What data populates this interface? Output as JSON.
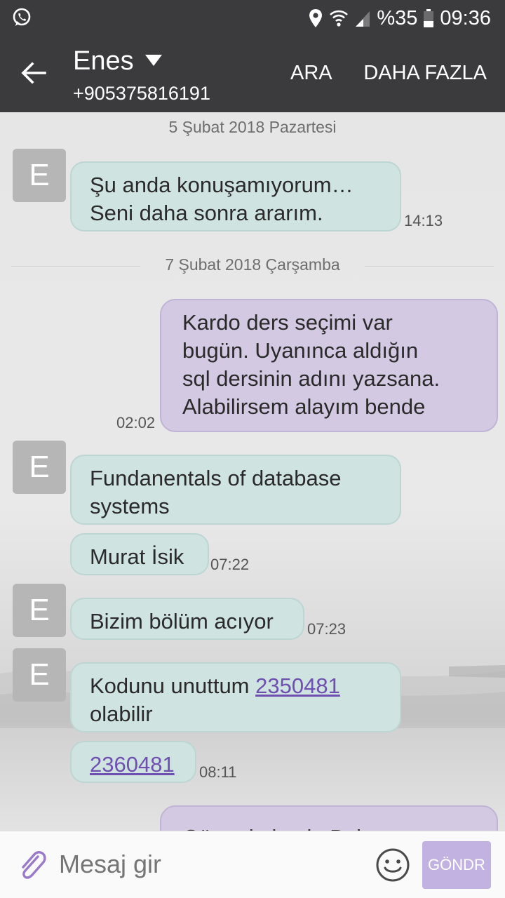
{
  "status_bar": {
    "battery": "%35",
    "time": "09:36"
  },
  "header": {
    "contact_name": "Enes",
    "phone": "+905375816191",
    "call_label": "ARA",
    "more_label": "DAHA FAZLA"
  },
  "chat": {
    "dates": [
      "5 Şubat 2018 Pazartesi",
      "7 Şubat 2018 Çarşamba"
    ],
    "avatar_letter": "E",
    "messages": [
      {
        "direction": "in",
        "lines": [
          "Şu anda konuşamıyorum…",
          "Seni daha sonra ararım."
        ],
        "time": "14:13"
      },
      {
        "direction": "out",
        "lines": [
          "Kardo ders seçimi var",
          "bugün. Uyanınca aldığın",
          "sql dersinin adını yazsana.",
          "Alabilirsem alayım bende"
        ],
        "time": "02:02"
      },
      {
        "direction": "in",
        "lines": [
          "Fundanentals of database",
          "systems"
        ]
      },
      {
        "direction": "in",
        "lines": [
          "Murat İsik"
        ],
        "time": "07:22"
      },
      {
        "direction": "in",
        "lines": [
          "Bizim bölüm acıyor"
        ],
        "time": "07:23"
      },
      {
        "direction": "in",
        "text_before_link": "Kodunu unuttum ",
        "link": "2350481",
        "line2": "olabilir"
      },
      {
        "direction": "in",
        "link": "2360481",
        "time": "08:11"
      },
      {
        "direction": "out",
        "partial_text": "Güne de bazla Balen"
      }
    ]
  },
  "composer": {
    "placeholder": "Mesaj gir",
    "send_label": "GÖNDR"
  },
  "colors": {
    "bar": "#3b3b3d",
    "incoming_bubble": "#cfe3e1",
    "outgoing_bubble": "#d3c9e3",
    "link": "#6f4fb0",
    "send_button": "#c2b2e1"
  },
  "icons": [
    "whatsapp-icon",
    "location-icon",
    "wifi-icon",
    "signal-icon",
    "battery-icon",
    "back-arrow-icon",
    "dropdown-caret-icon",
    "paperclip-icon",
    "smiley-icon"
  ]
}
